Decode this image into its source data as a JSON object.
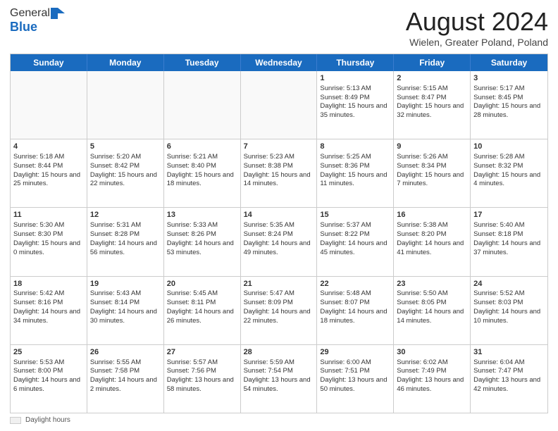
{
  "header": {
    "logo_general": "General",
    "logo_blue": "Blue",
    "month_title": "August 2024",
    "location": "Wielen, Greater Poland, Poland"
  },
  "footer": {
    "label": "Daylight hours"
  },
  "days_of_week": [
    "Sunday",
    "Monday",
    "Tuesday",
    "Wednesday",
    "Thursday",
    "Friday",
    "Saturday"
  ],
  "weeks": [
    [
      {
        "day": "",
        "text": "",
        "empty": true
      },
      {
        "day": "",
        "text": "",
        "empty": true
      },
      {
        "day": "",
        "text": "",
        "empty": true
      },
      {
        "day": "",
        "text": "",
        "empty": true
      },
      {
        "day": "1",
        "text": "Sunrise: 5:13 AM\nSunset: 8:49 PM\nDaylight: 15 hours and 35 minutes."
      },
      {
        "day": "2",
        "text": "Sunrise: 5:15 AM\nSunset: 8:47 PM\nDaylight: 15 hours and 32 minutes."
      },
      {
        "day": "3",
        "text": "Sunrise: 5:17 AM\nSunset: 8:45 PM\nDaylight: 15 hours and 28 minutes."
      }
    ],
    [
      {
        "day": "4",
        "text": "Sunrise: 5:18 AM\nSunset: 8:44 PM\nDaylight: 15 hours and 25 minutes."
      },
      {
        "day": "5",
        "text": "Sunrise: 5:20 AM\nSunset: 8:42 PM\nDaylight: 15 hours and 22 minutes."
      },
      {
        "day": "6",
        "text": "Sunrise: 5:21 AM\nSunset: 8:40 PM\nDaylight: 15 hours and 18 minutes."
      },
      {
        "day": "7",
        "text": "Sunrise: 5:23 AM\nSunset: 8:38 PM\nDaylight: 15 hours and 14 minutes."
      },
      {
        "day": "8",
        "text": "Sunrise: 5:25 AM\nSunset: 8:36 PM\nDaylight: 15 hours and 11 minutes."
      },
      {
        "day": "9",
        "text": "Sunrise: 5:26 AM\nSunset: 8:34 PM\nDaylight: 15 hours and 7 minutes."
      },
      {
        "day": "10",
        "text": "Sunrise: 5:28 AM\nSunset: 8:32 PM\nDaylight: 15 hours and 4 minutes."
      }
    ],
    [
      {
        "day": "11",
        "text": "Sunrise: 5:30 AM\nSunset: 8:30 PM\nDaylight: 15 hours and 0 minutes."
      },
      {
        "day": "12",
        "text": "Sunrise: 5:31 AM\nSunset: 8:28 PM\nDaylight: 14 hours and 56 minutes."
      },
      {
        "day": "13",
        "text": "Sunrise: 5:33 AM\nSunset: 8:26 PM\nDaylight: 14 hours and 53 minutes."
      },
      {
        "day": "14",
        "text": "Sunrise: 5:35 AM\nSunset: 8:24 PM\nDaylight: 14 hours and 49 minutes."
      },
      {
        "day": "15",
        "text": "Sunrise: 5:37 AM\nSunset: 8:22 PM\nDaylight: 14 hours and 45 minutes."
      },
      {
        "day": "16",
        "text": "Sunrise: 5:38 AM\nSunset: 8:20 PM\nDaylight: 14 hours and 41 minutes."
      },
      {
        "day": "17",
        "text": "Sunrise: 5:40 AM\nSunset: 8:18 PM\nDaylight: 14 hours and 37 minutes."
      }
    ],
    [
      {
        "day": "18",
        "text": "Sunrise: 5:42 AM\nSunset: 8:16 PM\nDaylight: 14 hours and 34 minutes."
      },
      {
        "day": "19",
        "text": "Sunrise: 5:43 AM\nSunset: 8:14 PM\nDaylight: 14 hours and 30 minutes."
      },
      {
        "day": "20",
        "text": "Sunrise: 5:45 AM\nSunset: 8:11 PM\nDaylight: 14 hours and 26 minutes."
      },
      {
        "day": "21",
        "text": "Sunrise: 5:47 AM\nSunset: 8:09 PM\nDaylight: 14 hours and 22 minutes."
      },
      {
        "day": "22",
        "text": "Sunrise: 5:48 AM\nSunset: 8:07 PM\nDaylight: 14 hours and 18 minutes."
      },
      {
        "day": "23",
        "text": "Sunrise: 5:50 AM\nSunset: 8:05 PM\nDaylight: 14 hours and 14 minutes."
      },
      {
        "day": "24",
        "text": "Sunrise: 5:52 AM\nSunset: 8:03 PM\nDaylight: 14 hours and 10 minutes."
      }
    ],
    [
      {
        "day": "25",
        "text": "Sunrise: 5:53 AM\nSunset: 8:00 PM\nDaylight: 14 hours and 6 minutes."
      },
      {
        "day": "26",
        "text": "Sunrise: 5:55 AM\nSunset: 7:58 PM\nDaylight: 14 hours and 2 minutes."
      },
      {
        "day": "27",
        "text": "Sunrise: 5:57 AM\nSunset: 7:56 PM\nDaylight: 13 hours and 58 minutes."
      },
      {
        "day": "28",
        "text": "Sunrise: 5:59 AM\nSunset: 7:54 PM\nDaylight: 13 hours and 54 minutes."
      },
      {
        "day": "29",
        "text": "Sunrise: 6:00 AM\nSunset: 7:51 PM\nDaylight: 13 hours and 50 minutes."
      },
      {
        "day": "30",
        "text": "Sunrise: 6:02 AM\nSunset: 7:49 PM\nDaylight: 13 hours and 46 minutes."
      },
      {
        "day": "31",
        "text": "Sunrise: 6:04 AM\nSunset: 7:47 PM\nDaylight: 13 hours and 42 minutes."
      }
    ]
  ]
}
